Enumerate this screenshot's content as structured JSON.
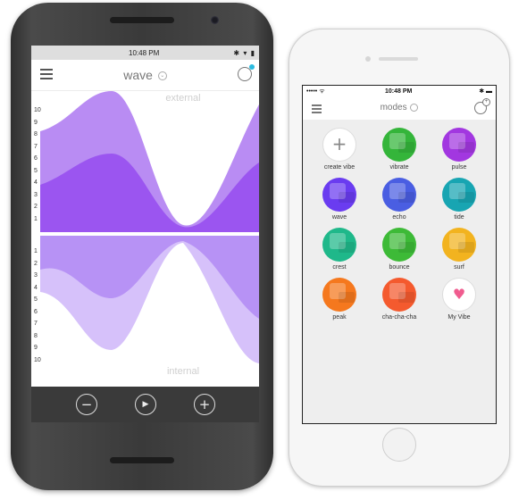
{
  "android": {
    "status_time": "10:48 PM",
    "status_icons": "✱ ▾ ▮",
    "title": "wave",
    "top_label": "external",
    "bottom_label": "internal",
    "axis_top": [
      "10",
      "9",
      "8",
      "7",
      "6",
      "5",
      "4",
      "3",
      "2",
      "1"
    ],
    "axis_bottom": [
      "1",
      "2",
      "3",
      "4",
      "5",
      "6",
      "7",
      "8",
      "9",
      "10"
    ],
    "controls": {
      "minus": "−",
      "play": "▶",
      "plus": "+"
    },
    "colors": {
      "top_dark": "#9b55f0",
      "top_light": "#b98cf3",
      "bottom_dark": "#b792f5",
      "bottom_light": "#d6c1fa"
    }
  },
  "iphone": {
    "status_time": "10:48 PM",
    "status_left": "••••• ᯤ",
    "status_right": "✱ ▬",
    "title": "modes",
    "modes": [
      {
        "label": "create vibe",
        "icon": "plus-icon",
        "color": "#ffffff"
      },
      {
        "label": "vibrate",
        "icon": "vibrate-icon",
        "color": "#34b53a"
      },
      {
        "label": "pulse",
        "icon": "pulse-icon",
        "color": "#a237e0"
      },
      {
        "label": "wave",
        "icon": "wave-icon",
        "color": "#6a3cf0"
      },
      {
        "label": "echo",
        "icon": "echo-icon",
        "color": "#4a5ee2"
      },
      {
        "label": "tide",
        "icon": "tide-icon",
        "color": "#18a5b2"
      },
      {
        "label": "crest",
        "icon": "crest-icon",
        "color": "#1fb88a"
      },
      {
        "label": "bounce",
        "icon": "bounce-icon",
        "color": "#3dba37"
      },
      {
        "label": "surf",
        "icon": "surf-icon",
        "color": "#f2b31f"
      },
      {
        "label": "peak",
        "icon": "peak-icon",
        "color": "#f5781e"
      },
      {
        "label": "cha-cha-cha",
        "icon": "cha-cha-cha-icon",
        "color": "#f45a2e"
      },
      {
        "label": "My Vibe",
        "icon": "heart-icon",
        "color": "#ffffff"
      }
    ]
  }
}
